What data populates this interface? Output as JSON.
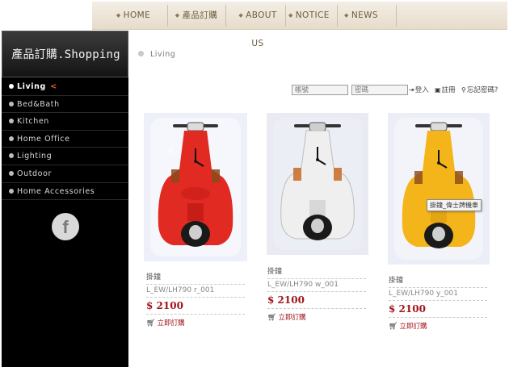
{
  "nav": {
    "items": [
      {
        "label": "HOME"
      },
      {
        "label": "產品訂購"
      },
      {
        "label": "ABOUT US"
      },
      {
        "label": "NOTICE"
      },
      {
        "label": "NEWS"
      }
    ]
  },
  "sidebar": {
    "brand": "產品訂購.Shopping",
    "items": [
      {
        "label": "Living",
        "active": true
      },
      {
        "label": "Bed&Bath"
      },
      {
        "label": "Kitchen"
      },
      {
        "label": "Home Office"
      },
      {
        "label": "Lighting"
      },
      {
        "label": "Outdoor"
      },
      {
        "label": "Home Accessories"
      }
    ],
    "facebook_glyph": "f"
  },
  "breadcrumb": {
    "label": "Living"
  },
  "login": {
    "account_placeholder": "帳號",
    "password_placeholder": "密碼",
    "login_label": "登入",
    "register_label": "註冊",
    "forgot_label": "忘記密碼?"
  },
  "products": [
    {
      "category": "掛鐘",
      "code": "L_EW/LH790 r_001",
      "price": "$ 2100",
      "buy_label": "立即訂購",
      "color": "#e02a22"
    },
    {
      "category": "掛鐘",
      "code": "L_EW/LH790 w_001",
      "price": "$ 2100",
      "buy_label": "立即訂購",
      "color": "#efefef"
    },
    {
      "category": "掛鐘",
      "code": "L_EW/LH790 y_001",
      "price": "$ 2100",
      "buy_label": "立即訂購",
      "color": "#f3b51a"
    }
  ],
  "tooltip": "掛鐘_偉士牌機車",
  "colors": {
    "accent_red": "#a0151b",
    "nav_text": "#6d5b3e",
    "sidebar_bg": "#000000",
    "active_arrow": "#e0622a"
  }
}
